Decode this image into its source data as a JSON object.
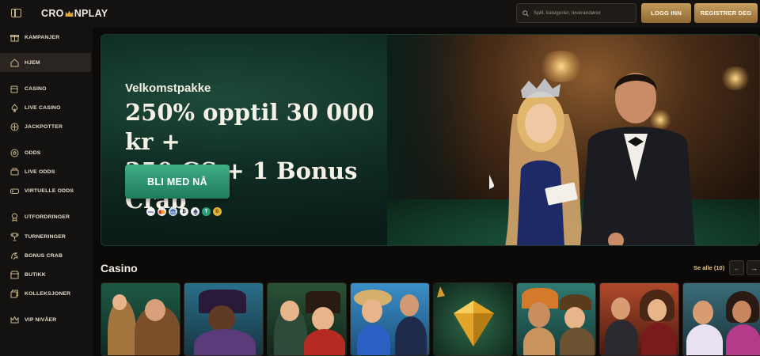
{
  "header": {
    "logo_text_left": "CRO",
    "logo_text_right": "NPLAY",
    "search_placeholder": "Spill, kategorier, leverandører",
    "login_label": "LOGG INN",
    "register_label": "REGISTRER DEG"
  },
  "sidebar": {
    "items": [
      {
        "label": "KAMPANJER",
        "icon": "gift-icon"
      },
      {
        "label": "HJEM",
        "icon": "home-icon",
        "active": true
      },
      {
        "label": "CASINO",
        "icon": "slot-machine-icon"
      },
      {
        "label": "LIVE CASINO",
        "icon": "spade-icon"
      },
      {
        "label": "JACKPOTTER",
        "icon": "jackpot-icon"
      },
      {
        "label": "ODDS",
        "icon": "football-icon"
      },
      {
        "label": "LIVE ODDS",
        "icon": "live-odds-icon"
      },
      {
        "label": "VIRTUELLE ODDS",
        "icon": "gamepad-icon"
      },
      {
        "label": "UTFORDRINGER",
        "icon": "medal-icon"
      },
      {
        "label": "TURNERINGER",
        "icon": "trophy-icon"
      },
      {
        "label": "BONUS CRAB",
        "icon": "claw-icon"
      },
      {
        "label": "BUTIKK",
        "icon": "shop-icon"
      },
      {
        "label": "KOLLEKSJONER",
        "icon": "collection-icon"
      },
      {
        "label": "VIP NIVÅER",
        "icon": "crown-icon"
      }
    ]
  },
  "hero": {
    "subtitle": "Velkomstpakke",
    "title_line1": "250% opptil 30 000 kr +",
    "title_line2": "350 GS + 1 Bonus Crab",
    "cta_label": "BLI MED NÅ",
    "payments": [
      "VISA",
      "MC",
      "B",
      "BTC",
      "ETH",
      "USDT",
      "DOGE"
    ]
  },
  "casino_section": {
    "title": "Casino",
    "see_all_label": "Se alle (10)",
    "games": [
      {
        "name": "viking-game"
      },
      {
        "name": "pirate-game"
      },
      {
        "name": "circus-game"
      },
      {
        "name": "beach-couple-game"
      },
      {
        "name": "diamond-game"
      },
      {
        "name": "aztec-explorer-game"
      },
      {
        "name": "poker-couple-game"
      },
      {
        "name": "magician-game"
      }
    ]
  },
  "colors": {
    "gold_accent": "#c29a5a",
    "cta_green": "#2f9a72",
    "background": "#0f0d0b"
  }
}
